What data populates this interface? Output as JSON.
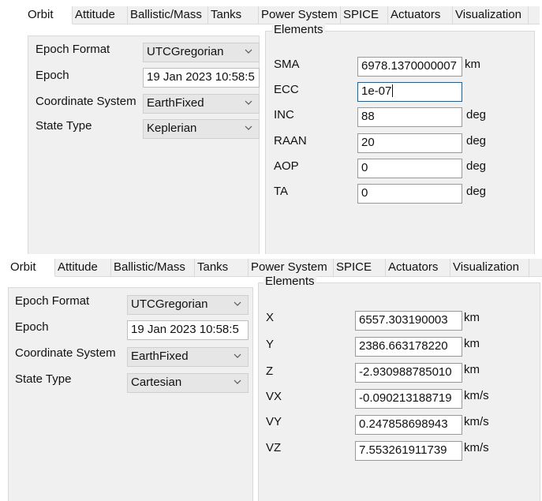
{
  "panel_top": {
    "tabs": [
      "Orbit",
      "Attitude",
      "Ballistic/Mass",
      "Tanks",
      "Power System",
      "SPICE",
      "Actuators",
      "Visualization"
    ],
    "left_labels": [
      "Epoch Format",
      "Epoch",
      "Coordinate System",
      "State Type"
    ],
    "epoch_format": "UTCGregorian",
    "epoch": "19 Jan 2023 10:58:5",
    "coordinate_system": "EarthFixed",
    "state_type": "Keplerian",
    "elements_legend": "Elements",
    "elements": [
      {
        "label": "SMA",
        "value": "6978.1370000007",
        "unit": "km"
      },
      {
        "label": "ECC",
        "value": "1e-07",
        "unit": ""
      },
      {
        "label": "INC",
        "value": "88",
        "unit": "deg"
      },
      {
        "label": "RAAN",
        "value": "20",
        "unit": "deg"
      },
      {
        "label": "AOP",
        "value": "0",
        "unit": "deg"
      },
      {
        "label": "TA",
        "value": "0",
        "unit": "deg"
      }
    ]
  },
  "panel_bottom": {
    "tabs": [
      "Orbit",
      "Attitude",
      "Ballistic/Mass",
      "Tanks",
      "Power System",
      "SPICE",
      "Actuators",
      "Visualization"
    ],
    "left_labels": [
      "Epoch Format",
      "Epoch",
      "Coordinate System",
      "State Type"
    ],
    "epoch_format": "UTCGregorian",
    "epoch": "19 Jan 2023 10:58:5",
    "coordinate_system": "EarthFixed",
    "state_type": "Cartesian",
    "elements_legend": "Elements",
    "elements": [
      {
        "label": "X",
        "value": "6557.303190003",
        "unit": "km"
      },
      {
        "label": "Y",
        "value": "2386.663178220",
        "unit": "km"
      },
      {
        "label": "Z",
        "value": "-2.930988785010",
        "unit": "km"
      },
      {
        "label": "VX",
        "value": "-0.090213188719",
        "unit": "km/s"
      },
      {
        "label": "VY",
        "value": "0.247858698943",
        "unit": "km/s"
      },
      {
        "label": "VZ",
        "value": "7.553261911739",
        "unit": "km/s"
      }
    ]
  },
  "icons": {
    "dropdown": "chevron-down-icon"
  }
}
